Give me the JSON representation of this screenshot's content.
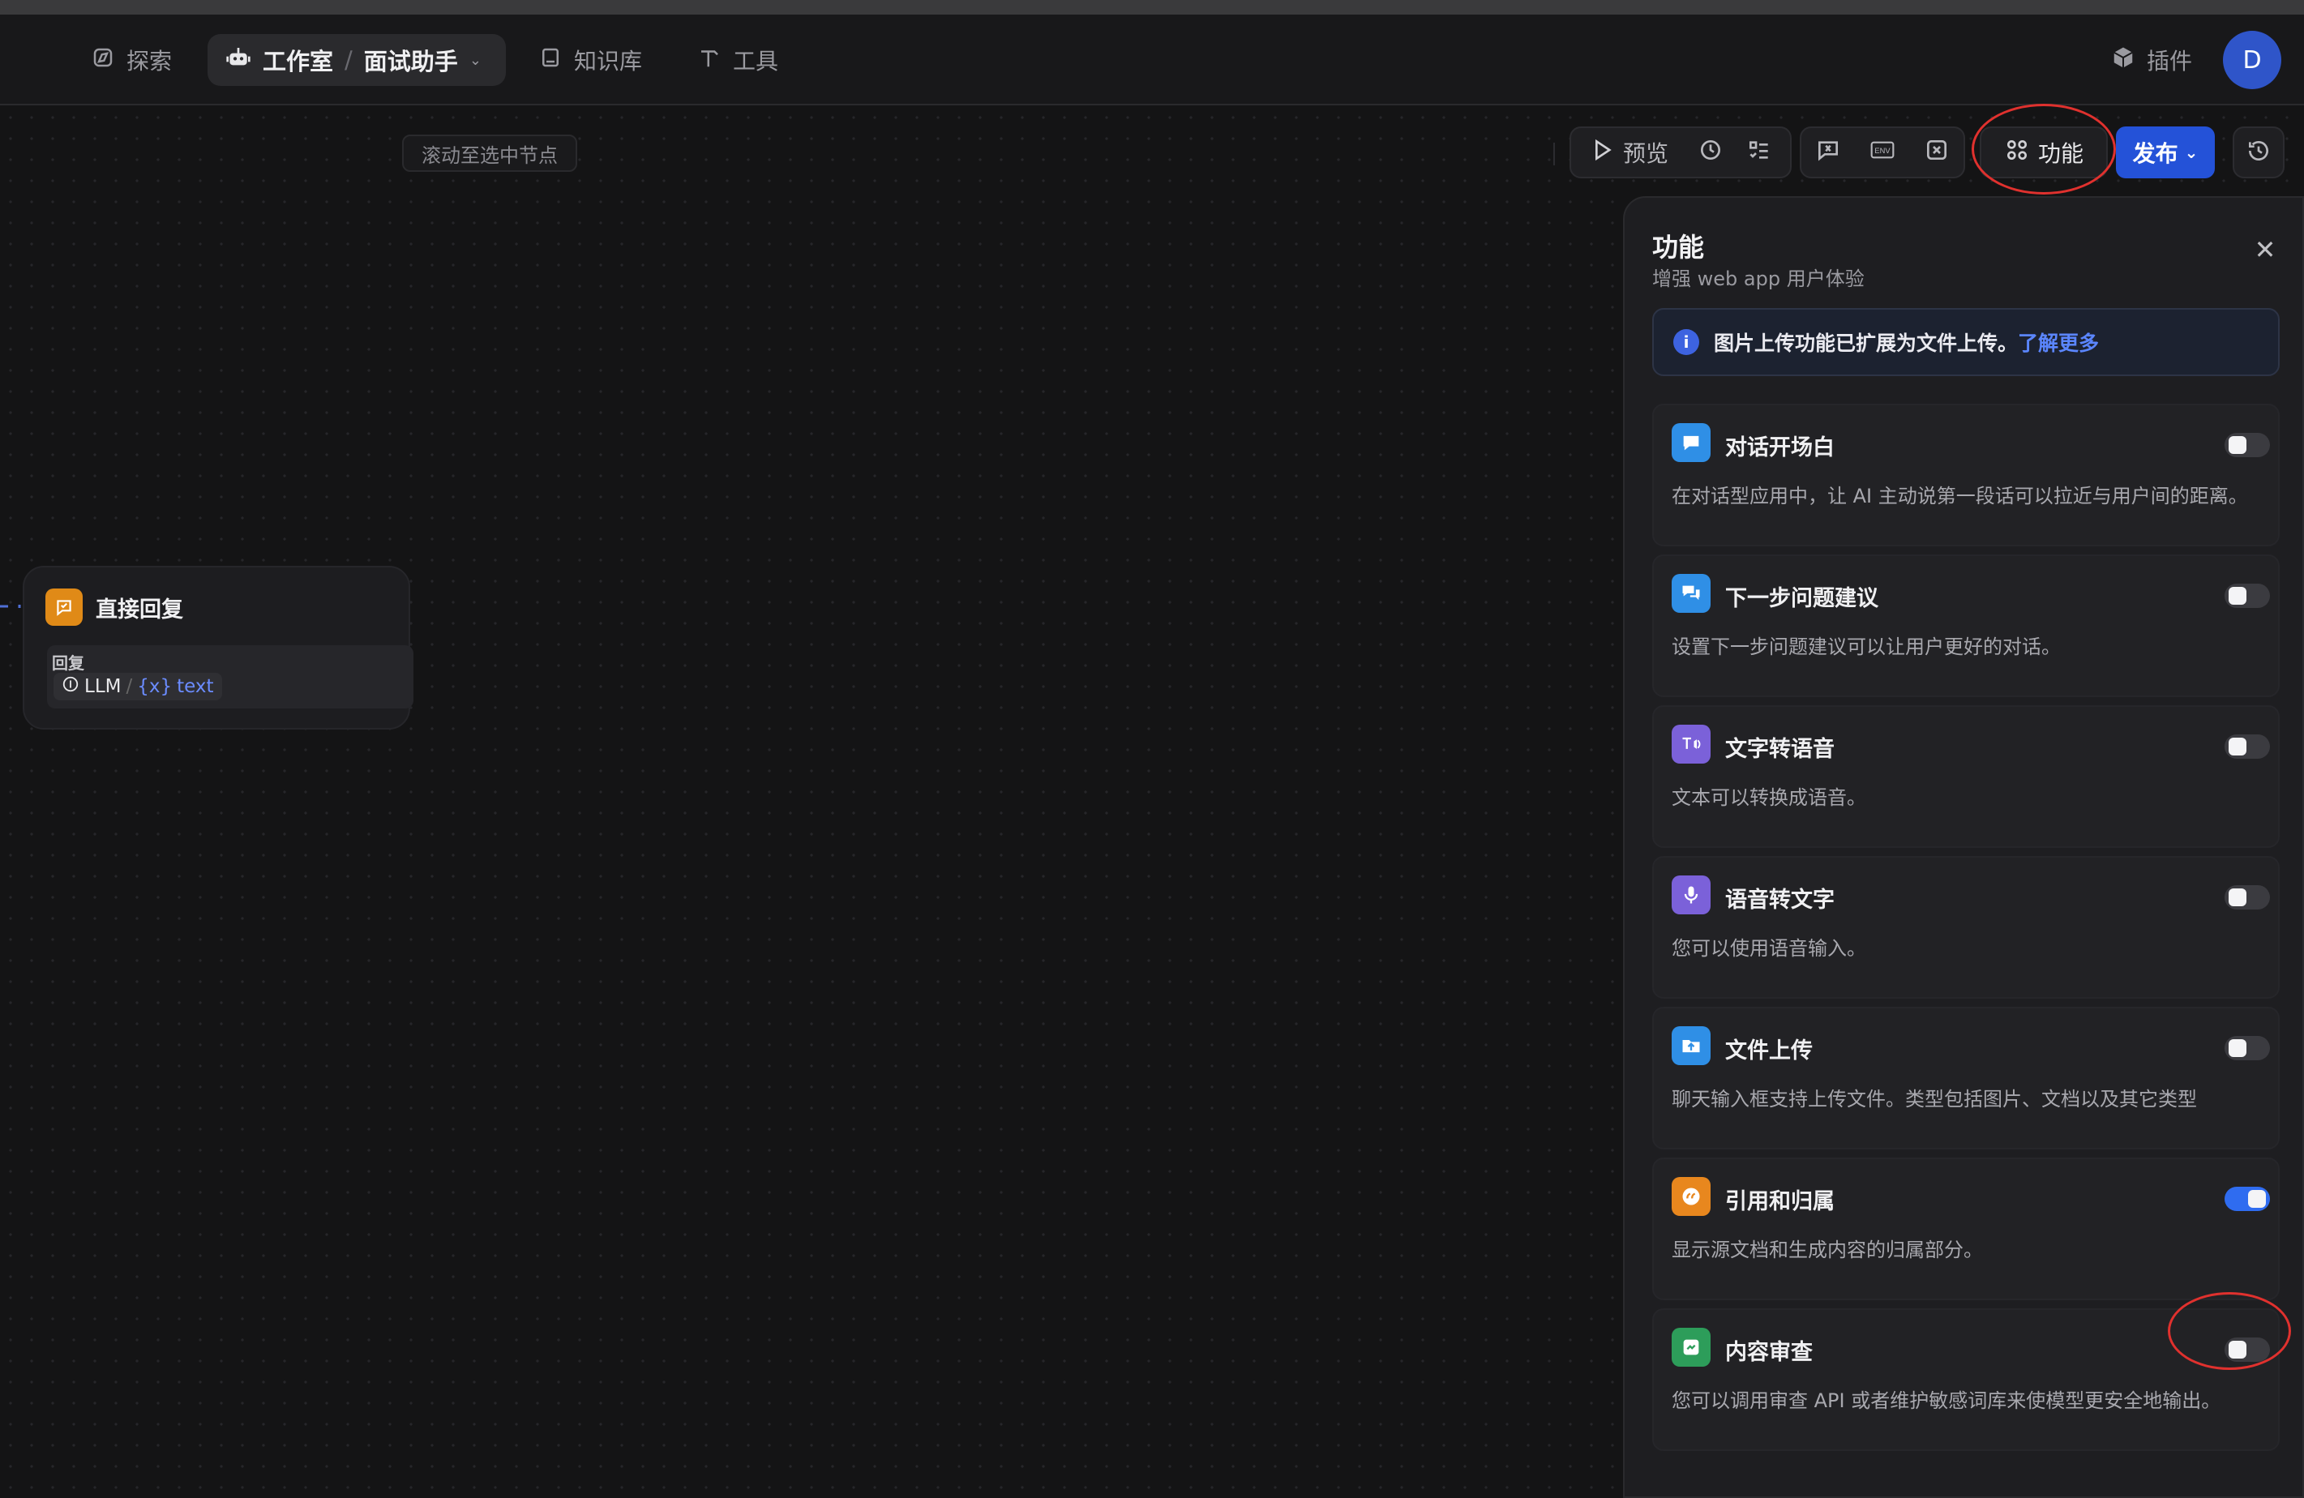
{
  "nav": {
    "explore": "探索",
    "studio": "工作室",
    "separator": "/",
    "app_name": "面试助手",
    "knowledge": "知识库",
    "tools": "工具",
    "plugins": "插件",
    "avatar_initial": "D"
  },
  "canvas": {
    "scroll_to_selected": "滚动至选中节点"
  },
  "toolbar": {
    "preview": "预览",
    "features": "功能",
    "publish": "发布"
  },
  "node": {
    "title": "直接回复",
    "field_label": "回复",
    "source_node": "LLM",
    "separator": "/",
    "variable_prefix": "{x}",
    "variable": "text"
  },
  "panel": {
    "title": "功能",
    "subtitle": "增强 web app 用户体验",
    "notice": "图片上传功能已扩展为文件上传。",
    "notice_link": "了解更多",
    "features": [
      {
        "title": "对话开场白",
        "description": "在对话型应用中，让 AI 主动说第一段话可以拉近与用户间的距离。",
        "enabled": false,
        "icon": "chat-bubble-icon",
        "color": "#2f8fe6"
      },
      {
        "title": "下一步问题建议",
        "description": "设置下一步问题建议可以让用户更好的对话。",
        "enabled": false,
        "icon": "messages-icon",
        "color": "#2f8fe6"
      },
      {
        "title": "文字转语音",
        "description": "文本可以转换成语音。",
        "enabled": false,
        "icon": "text-to-speech-icon",
        "color": "#7b61d9"
      },
      {
        "title": "语音转文字",
        "description": "您可以使用语音输入。",
        "enabled": false,
        "icon": "microphone-icon",
        "color": "#7b61d9"
      },
      {
        "title": "文件上传",
        "description": "聊天输入框支持上传文件。类型包括图片、文档以及其它类型",
        "enabled": false,
        "icon": "file-upload-icon",
        "color": "#2f8fe6"
      },
      {
        "title": "引用和归属",
        "description": "显示源文档和生成内容的归属部分。",
        "enabled": true,
        "icon": "quote-icon",
        "color": "#e8871e"
      },
      {
        "title": "内容审查",
        "description": "您可以调用审查 API 或者维护敏感词库来使模型更安全地输出。",
        "enabled": false,
        "icon": "moderation-icon",
        "color": "#2d9d5a"
      }
    ]
  },
  "colors": {
    "accent": "#2452d8",
    "annotation": "#e0312e",
    "toggle_on": "#2f6cf0"
  }
}
